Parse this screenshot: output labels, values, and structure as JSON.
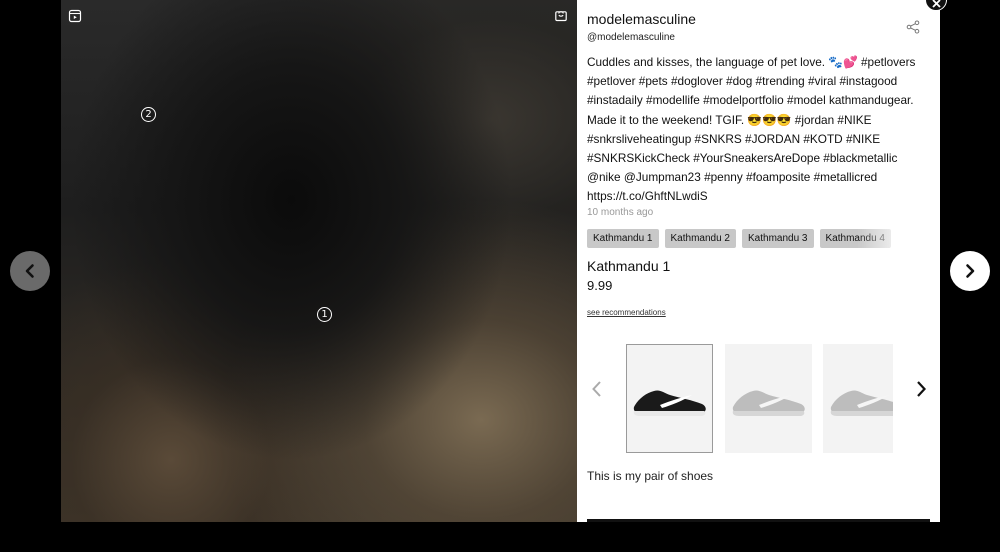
{
  "post": {
    "username": "modelemasculine",
    "handle": "@modelemasculine",
    "caption": "Cuddles and kisses, the language of pet love. 🐾💕 #petlovers #petlover #pets #doglover #dog #trending #viral #instagood #instadaily #modellife #modelportfolio #model kathmandugear. Made it to the weekend! TGIF. 😎😎😎 #jordan #NIKE #snkrsliveheatingup #SNKRS #JORDAN #KOTD #NIKE #SNKRSKickCheck #YourSneakersAreDope #blackmetallic @nike @Jumpman23 #penny #foamposite #metallicred https://t.co/GhftNLwdiS",
    "timestamp": "10 months ago"
  },
  "media": {
    "hotspots": [
      "1",
      "2"
    ],
    "top_left_icon": "reel-icon",
    "top_right_icon": "shopping-bag-icon"
  },
  "tags": [
    "Kathmandu 1",
    "Kathmandu 2",
    "Kathmandu 3",
    "Kathmandu 4"
  ],
  "product": {
    "name": "Kathmandu 1",
    "price": "9.99",
    "see_recommendations": "see recommendations",
    "description": "This is my pair of shoes"
  },
  "carousel": {
    "thumbnails": [
      {
        "name": "black-sneaker",
        "color": "#1a1a1a",
        "selected": true
      },
      {
        "name": "grey-sneaker",
        "color": "#bdbdbd",
        "selected": false
      },
      {
        "name": "grey-sneaker",
        "color": "#bdbdbd",
        "selected": false
      }
    ]
  },
  "colors": {
    "overlay": "#000000",
    "tag_bg": "#c8c8c8",
    "timestamp": "#999999"
  }
}
